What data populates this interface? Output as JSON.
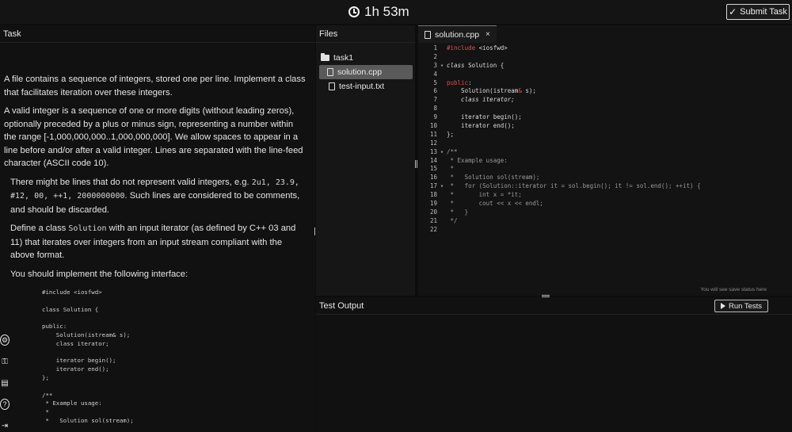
{
  "topbar": {
    "timer": "1h 53m",
    "submit_label": "Submit Task"
  },
  "task": {
    "header": "Task",
    "paragraphs": {
      "p1": "A file contains a sequence of integers, stored one per line. Implement a class that facilitates iteration over these integers.",
      "p2": "A valid integer is a sequence of one or more digits (without leading zeros), optionally preceded by a plus or minus sign, representing a number within the range [-1,000,000,000..1,000,000,000]. We allow spaces to appear in a line before and/or after a valid integer. Lines are separated with the line-feed character (ASCII code 10).",
      "p3_pre": "There might be lines that do not represent valid integers, e.g. ",
      "p3_code": "2u1, 23.9, #12, 00, ++1, 2000000000",
      "p3_post": ". Such lines are considered to be comments, and should be discarded.",
      "p4_pre": "Define a class ",
      "p4_code": "Solution",
      "p4_post": " with an input iterator (as defined by C++ 03 and 11) that iterates over integers from an input stream compliant with the above format.",
      "p5": "You should implement the following interface:"
    },
    "code_snippet": "#include <iosfwd>\n\nclass Solution {\n\npublic:\n    Solution(istream& s);\n    class iterator;\n\n    iterator begin();\n    iterator end();\n};\n\n/**\n * Example usage:\n *\n *   Solution sol(stream);"
  },
  "files": {
    "header": "Files",
    "folder": "task1",
    "items": [
      "solution.cpp",
      "test-input.txt"
    ]
  },
  "editor": {
    "tab_label": "solution.cpp",
    "close_glyph": "×",
    "lines": [
      {
        "n": "1",
        "fold": "",
        "parts": [
          {
            "t": "#include",
            "c": "kw"
          },
          {
            "t": " <iosfwd>",
            "c": "src"
          }
        ]
      },
      {
        "n": "2",
        "fold": "",
        "parts": []
      },
      {
        "n": "3",
        "fold": "▾",
        "parts": [
          {
            "t": "class",
            "c": "src it"
          },
          {
            "t": " Solution {",
            "c": "src"
          }
        ]
      },
      {
        "n": "4",
        "fold": "",
        "parts": []
      },
      {
        "n": "5",
        "fold": "",
        "parts": [
          {
            "t": "public",
            "c": "kw"
          },
          {
            "t": ":",
            "c": "src"
          }
        ]
      },
      {
        "n": "6",
        "fold": "",
        "parts": [
          {
            "t": "    Solution(istream",
            "c": "src"
          },
          {
            "t": "&",
            "c": "kw"
          },
          {
            "t": " s);",
            "c": "src"
          }
        ]
      },
      {
        "n": "7",
        "fold": "",
        "parts": [
          {
            "t": "    class",
            "c": "src it"
          },
          {
            "t": " iterator;",
            "c": "src it"
          }
        ]
      },
      {
        "n": "8",
        "fold": "",
        "parts": []
      },
      {
        "n": "9",
        "fold": "",
        "parts": [
          {
            "t": "    iterator begin();",
            "c": "src"
          }
        ]
      },
      {
        "n": "10",
        "fold": "",
        "parts": [
          {
            "t": "    iterator end();",
            "c": "src"
          }
        ]
      },
      {
        "n": "11",
        "fold": "",
        "parts": [
          {
            "t": "};",
            "c": "src"
          }
        ]
      },
      {
        "n": "12",
        "fold": "",
        "parts": []
      },
      {
        "n": "13",
        "fold": "▾",
        "parts": [
          {
            "t": "/**",
            "c": "cm"
          }
        ]
      },
      {
        "n": "14",
        "fold": "",
        "parts": [
          {
            "t": " * Example usage:",
            "c": "cm"
          }
        ]
      },
      {
        "n": "15",
        "fold": "",
        "parts": [
          {
            "t": " *",
            "c": "cm"
          }
        ]
      },
      {
        "n": "16",
        "fold": "",
        "parts": [
          {
            "t": " *   Solution sol(stream);",
            "c": "cm"
          }
        ]
      },
      {
        "n": "17",
        "fold": "▾",
        "parts": [
          {
            "t": " *   for (Solution::iterator it = sol.begin(); it != sol.end(); ++it) {",
            "c": "cm"
          }
        ]
      },
      {
        "n": "18",
        "fold": "",
        "parts": [
          {
            "t": " *       int x = *it;",
            "c": "cm"
          }
        ]
      },
      {
        "n": "19",
        "fold": "",
        "parts": [
          {
            "t": " *       cout << x << endl;",
            "c": "cm"
          }
        ]
      },
      {
        "n": "20",
        "fold": "",
        "parts": [
          {
            "t": " *   }",
            "c": "cm"
          }
        ]
      },
      {
        "n": "21",
        "fold": "",
        "parts": [
          {
            "t": " */",
            "c": "cm"
          }
        ]
      },
      {
        "n": "22",
        "fold": "",
        "parts": []
      }
    ],
    "status_hint": "You will see save status here"
  },
  "test_output": {
    "header": "Test Output",
    "run_label": "Run Tests"
  },
  "icons": [
    "clock-icon",
    "check-icon",
    "folder-icon",
    "file-icon",
    "play-icon",
    "close-icon"
  ]
}
